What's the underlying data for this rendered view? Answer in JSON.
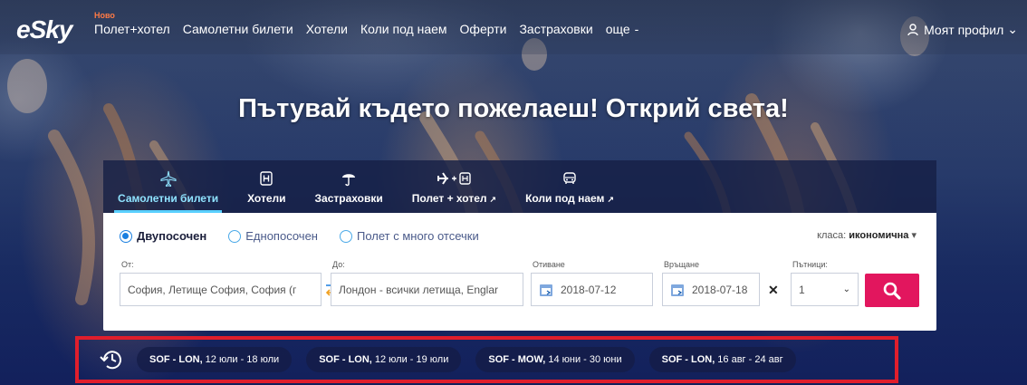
{
  "brand": {
    "logo": "eSky"
  },
  "nav": {
    "items": [
      {
        "label": "Полет+хотел",
        "badge": "Ново"
      },
      {
        "label": "Самолетни билети"
      },
      {
        "label": "Хотели"
      },
      {
        "label": "Коли под наем"
      },
      {
        "label": "Оферти"
      },
      {
        "label": "Застраховки"
      },
      {
        "label": "още"
      }
    ],
    "more_caret": "-",
    "profile": "Моят профил",
    "profile_caret": "⌄"
  },
  "headline": "Пътувай където пожелаеш! Открий света!",
  "tabs": [
    {
      "label": "Самолетни билети",
      "icon": "plane-icon",
      "active": true
    },
    {
      "label": "Хотели",
      "icon": "hotel-icon"
    },
    {
      "label": "Застраховки",
      "icon": "umbrella-icon"
    },
    {
      "label": "Полет + хотел",
      "icon": "plane-hotel-icon",
      "external": "↗"
    },
    {
      "label": "Коли под наем",
      "icon": "car-icon",
      "external": "↗"
    }
  ],
  "trip_types": [
    {
      "label": "Двупосочен",
      "selected": true
    },
    {
      "label": "Еднопосочен"
    },
    {
      "label": "Полет с много отсечки"
    }
  ],
  "cabin_class": {
    "label": "класа:",
    "value": "икономична",
    "caret": "▾"
  },
  "form": {
    "from": {
      "label": "От:",
      "value": "София, Летище София, София (г"
    },
    "to": {
      "label": "До:",
      "value": "Лондон - всички летища, Englar"
    },
    "depart": {
      "label": "Отиване",
      "value": "2018-07-12"
    },
    "return": {
      "label": "Връщане",
      "value": "2018-07-18"
    },
    "passengers": {
      "label": "Пътници:",
      "value": "1",
      "caret": "⌄"
    },
    "clear": "✕"
  },
  "colors": {
    "accent": "#e2165e",
    "highlight_border": "#e01e2c",
    "active_tab": "#8fe3ff",
    "radio": "#1a7fe0"
  },
  "recent": [
    {
      "route": "SOF - LON,",
      "dates": "12 юли - 18 юли"
    },
    {
      "route": "SOF - LON,",
      "dates": "12 юли - 19 юли"
    },
    {
      "route": "SOF - MOW,",
      "dates": "14 юни - 30 юни"
    },
    {
      "route": "SOF - LON,",
      "dates": "16 авг - 24 авг"
    }
  ]
}
